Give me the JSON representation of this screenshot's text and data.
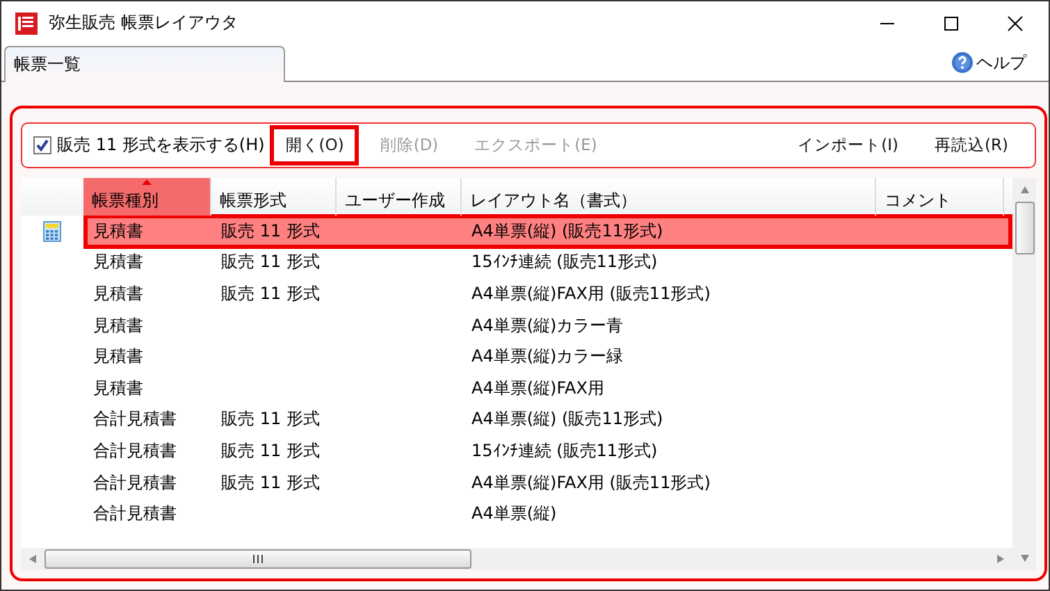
{
  "window": {
    "title": "弥生販売 帳票レイアウタ"
  },
  "tabs": [
    {
      "label": "帳票一覧",
      "selected": true
    }
  ],
  "help": {
    "label": "ヘルプ"
  },
  "toolbar": {
    "checkbox": {
      "label": "販売 11 形式を表示する(H)",
      "checked": true
    },
    "buttons": [
      {
        "label": "開く(O)",
        "disabled": false,
        "highlighted": true
      },
      {
        "label": "削除(D)",
        "disabled": true,
        "highlighted": false
      },
      {
        "label": "エクスポート(E)",
        "disabled": true,
        "highlighted": false
      },
      {
        "label": "インポート(I)",
        "disabled": false,
        "highlighted": false
      },
      {
        "label": "再読込(R)",
        "disabled": false,
        "highlighted": false
      }
    ]
  },
  "table": {
    "columns": [
      {
        "label": "帳票種別",
        "sorted": true
      },
      {
        "label": "帳票形式",
        "sorted": false
      },
      {
        "label": "ユーザー作成",
        "sorted": false
      },
      {
        "label": "レイアウト名（書式）",
        "sorted": false
      },
      {
        "label": "コメント",
        "sorted": false
      }
    ],
    "rows": [
      {
        "selected": true,
        "highlighted": true,
        "cells": [
          "見積書",
          "販売 11 形式",
          "",
          "A4単票(縦) (販売11形式)",
          ""
        ]
      },
      {
        "selected": false,
        "highlighted": false,
        "cells": [
          "見積書",
          "販売 11 形式",
          "",
          "15ｲﾝﾁ連続 (販売11形式)",
          ""
        ]
      },
      {
        "selected": false,
        "highlighted": false,
        "cells": [
          "見積書",
          "販売 11 形式",
          "",
          "A4単票(縦)FAX用 (販売11形式)",
          ""
        ]
      },
      {
        "selected": false,
        "highlighted": false,
        "cells": [
          "見積書",
          "",
          "",
          "A4単票(縦)カラー青",
          ""
        ]
      },
      {
        "selected": false,
        "highlighted": false,
        "cells": [
          "見積書",
          "",
          "",
          "A4単票(縦)カラー緑",
          ""
        ]
      },
      {
        "selected": false,
        "highlighted": false,
        "cells": [
          "見積書",
          "",
          "",
          "A4単票(縦)FAX用",
          ""
        ]
      },
      {
        "selected": false,
        "highlighted": false,
        "cells": [
          "合計見積書",
          "販売 11 形式",
          "",
          "A4単票(縦) (販売11形式)",
          ""
        ]
      },
      {
        "selected": false,
        "highlighted": false,
        "cells": [
          "合計見積書",
          "販売 11 形式",
          "",
          "15ｲﾝﾁ連続 (販売11形式)",
          ""
        ]
      },
      {
        "selected": false,
        "highlighted": false,
        "cells": [
          "合計見積書",
          "販売 11 形式",
          "",
          "A4単票(縦)FAX用 (販売11形式)",
          ""
        ]
      },
      {
        "selected": false,
        "highlighted": false,
        "cells": [
          "合計見積書",
          "",
          "",
          "A4単票(縦)",
          ""
        ]
      }
    ]
  }
}
